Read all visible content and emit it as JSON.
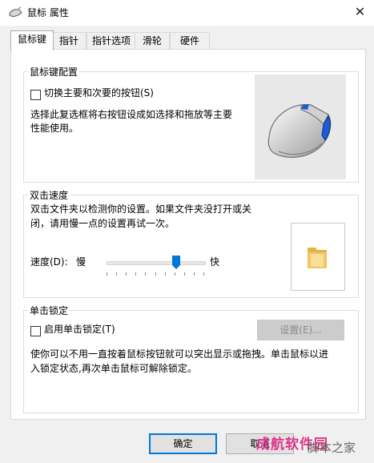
{
  "window": {
    "title": "鼠标 属性",
    "close_glyph": "✕"
  },
  "tabs": [
    {
      "label": "鼠标键",
      "active": true
    },
    {
      "label": "指针",
      "active": false
    },
    {
      "label": "指针选项",
      "active": false
    },
    {
      "label": "滑轮",
      "active": false
    },
    {
      "label": "硬件",
      "active": false
    }
  ],
  "button_config": {
    "group_title": "鼠标键配置",
    "checkbox_label": "切换主要和次要的按钮(S)",
    "checked": false,
    "description_line1": "选择此复选框将右按钮设成如选择和拖放等主要",
    "description_line2": "性能使用。"
  },
  "double_click": {
    "group_title": "双击速度",
    "description_line1": "双击文件夹以检测你的设置。如果文件夹没打开或关",
    "description_line2": "闭，请用慢一点的设置再试一次。",
    "speed_label": "速度(D):",
    "slow_label": "慢",
    "fast_label": "快",
    "speed_value": 0.73
  },
  "click_lock": {
    "group_title": "单击锁定",
    "checkbox_label": "启用单击锁定(T)",
    "checked": false,
    "settings_button": "设置(E)...",
    "description_line1": "使你可以不用一直按着鼠标按钮就可以突出显示或拖拽。单击鼠标以进",
    "description_line2": "入锁定状态,再次单击鼠标可解除锁定。"
  },
  "footer": {
    "ok": "确定",
    "cancel": "取消"
  },
  "watermark": {
    "brand": "成航软件园",
    "site": "脚本之家"
  },
  "colors": {
    "accent": "#0078d7",
    "folder": "#f0c75e",
    "mouse_accent": "#1e5bd6"
  }
}
